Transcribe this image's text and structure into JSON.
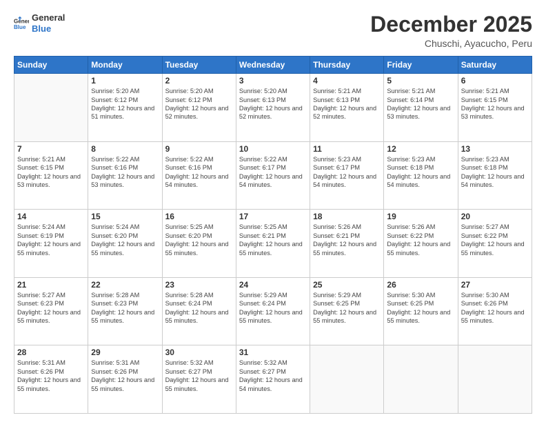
{
  "header": {
    "logo_general": "General",
    "logo_blue": "Blue",
    "title": "December 2025",
    "location": "Chuschi, Ayacucho, Peru"
  },
  "calendar": {
    "days_header": [
      "Sunday",
      "Monday",
      "Tuesday",
      "Wednesday",
      "Thursday",
      "Friday",
      "Saturday"
    ],
    "weeks": [
      {
        "days": [
          {
            "num": "",
            "empty": true
          },
          {
            "num": "1",
            "sunrise": "5:20 AM",
            "sunset": "6:12 PM",
            "daylight": "12 hours and 51 minutes."
          },
          {
            "num": "2",
            "sunrise": "5:20 AM",
            "sunset": "6:12 PM",
            "daylight": "12 hours and 52 minutes."
          },
          {
            "num": "3",
            "sunrise": "5:20 AM",
            "sunset": "6:13 PM",
            "daylight": "12 hours and 52 minutes."
          },
          {
            "num": "4",
            "sunrise": "5:21 AM",
            "sunset": "6:13 PM",
            "daylight": "12 hours and 52 minutes."
          },
          {
            "num": "5",
            "sunrise": "5:21 AM",
            "sunset": "6:14 PM",
            "daylight": "12 hours and 53 minutes."
          },
          {
            "num": "6",
            "sunrise": "5:21 AM",
            "sunset": "6:15 PM",
            "daylight": "12 hours and 53 minutes."
          }
        ]
      },
      {
        "days": [
          {
            "num": "7",
            "sunrise": "5:21 AM",
            "sunset": "6:15 PM",
            "daylight": "12 hours and 53 minutes."
          },
          {
            "num": "8",
            "sunrise": "5:22 AM",
            "sunset": "6:16 PM",
            "daylight": "12 hours and 53 minutes."
          },
          {
            "num": "9",
            "sunrise": "5:22 AM",
            "sunset": "6:16 PM",
            "daylight": "12 hours and 54 minutes."
          },
          {
            "num": "10",
            "sunrise": "5:22 AM",
            "sunset": "6:17 PM",
            "daylight": "12 hours and 54 minutes."
          },
          {
            "num": "11",
            "sunrise": "5:23 AM",
            "sunset": "6:17 PM",
            "daylight": "12 hours and 54 minutes."
          },
          {
            "num": "12",
            "sunrise": "5:23 AM",
            "sunset": "6:18 PM",
            "daylight": "12 hours and 54 minutes."
          },
          {
            "num": "13",
            "sunrise": "5:23 AM",
            "sunset": "6:18 PM",
            "daylight": "12 hours and 54 minutes."
          }
        ]
      },
      {
        "days": [
          {
            "num": "14",
            "sunrise": "5:24 AM",
            "sunset": "6:19 PM",
            "daylight": "12 hours and 55 minutes."
          },
          {
            "num": "15",
            "sunrise": "5:24 AM",
            "sunset": "6:20 PM",
            "daylight": "12 hours and 55 minutes."
          },
          {
            "num": "16",
            "sunrise": "5:25 AM",
            "sunset": "6:20 PM",
            "daylight": "12 hours and 55 minutes."
          },
          {
            "num": "17",
            "sunrise": "5:25 AM",
            "sunset": "6:21 PM",
            "daylight": "12 hours and 55 minutes."
          },
          {
            "num": "18",
            "sunrise": "5:26 AM",
            "sunset": "6:21 PM",
            "daylight": "12 hours and 55 minutes."
          },
          {
            "num": "19",
            "sunrise": "5:26 AM",
            "sunset": "6:22 PM",
            "daylight": "12 hours and 55 minutes."
          },
          {
            "num": "20",
            "sunrise": "5:27 AM",
            "sunset": "6:22 PM",
            "daylight": "12 hours and 55 minutes."
          }
        ]
      },
      {
        "days": [
          {
            "num": "21",
            "sunrise": "5:27 AM",
            "sunset": "6:23 PM",
            "daylight": "12 hours and 55 minutes."
          },
          {
            "num": "22",
            "sunrise": "5:28 AM",
            "sunset": "6:23 PM",
            "daylight": "12 hours and 55 minutes."
          },
          {
            "num": "23",
            "sunrise": "5:28 AM",
            "sunset": "6:24 PM",
            "daylight": "12 hours and 55 minutes."
          },
          {
            "num": "24",
            "sunrise": "5:29 AM",
            "sunset": "6:24 PM",
            "daylight": "12 hours and 55 minutes."
          },
          {
            "num": "25",
            "sunrise": "5:29 AM",
            "sunset": "6:25 PM",
            "daylight": "12 hours and 55 minutes."
          },
          {
            "num": "26",
            "sunrise": "5:30 AM",
            "sunset": "6:25 PM",
            "daylight": "12 hours and 55 minutes."
          },
          {
            "num": "27",
            "sunrise": "5:30 AM",
            "sunset": "6:26 PM",
            "daylight": "12 hours and 55 minutes."
          }
        ]
      },
      {
        "days": [
          {
            "num": "28",
            "sunrise": "5:31 AM",
            "sunset": "6:26 PM",
            "daylight": "12 hours and 55 minutes."
          },
          {
            "num": "29",
            "sunrise": "5:31 AM",
            "sunset": "6:26 PM",
            "daylight": "12 hours and 55 minutes."
          },
          {
            "num": "30",
            "sunrise": "5:32 AM",
            "sunset": "6:27 PM",
            "daylight": "12 hours and 55 minutes."
          },
          {
            "num": "31",
            "sunrise": "5:32 AM",
            "sunset": "6:27 PM",
            "daylight": "12 hours and 54 minutes."
          },
          {
            "num": "",
            "empty": true
          },
          {
            "num": "",
            "empty": true
          },
          {
            "num": "",
            "empty": true
          }
        ]
      }
    ]
  }
}
